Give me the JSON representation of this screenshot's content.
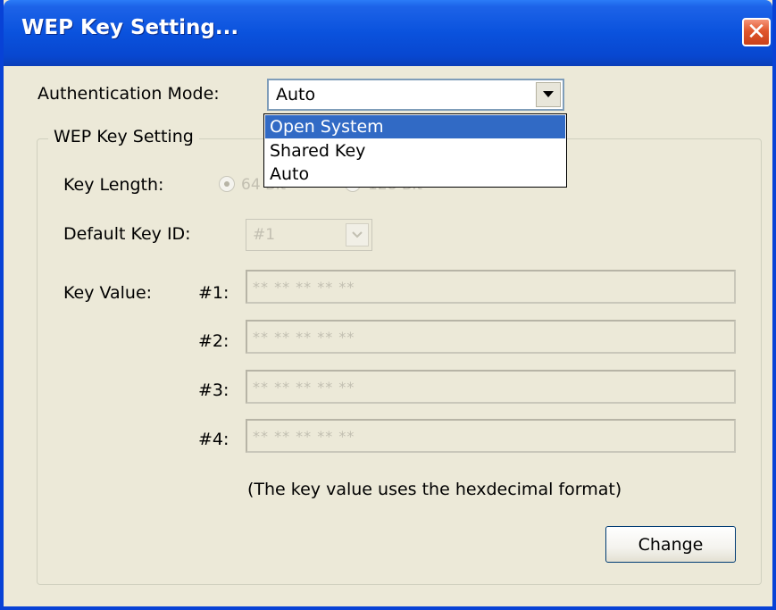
{
  "window": {
    "title": "WEP Key Setting..."
  },
  "auth": {
    "label": "Authentication Mode:",
    "selected": "Auto",
    "options": [
      "Open System",
      "Shared Key",
      "Auto"
    ],
    "highlighted_option": "Open System"
  },
  "group": {
    "legend": "WEP Key Setting",
    "key_length_label": "Key Length:",
    "key_length_options": [
      "64 Bit",
      "128 Bit"
    ],
    "key_length_selected": "64 Bit",
    "default_key_id_label": "Default Key ID:",
    "default_key_id_value": "#1",
    "key_value_label": "Key Value:",
    "keys": [
      {
        "id": "#1:",
        "value": "** ** ** ** **"
      },
      {
        "id": "#2:",
        "value": "** ** ** ** **"
      },
      {
        "id": "#3:",
        "value": "** ** ** ** **"
      },
      {
        "id": "#4:",
        "value": "** ** ** ** **"
      }
    ],
    "hint": "(The key value uses the hexdecimal format)",
    "change_label": "Change"
  },
  "colors": {
    "titlebar": "#0a52dd",
    "close": "#e0572d",
    "highlight": "#316ac5",
    "disabled_text": "#c2bfb1"
  }
}
